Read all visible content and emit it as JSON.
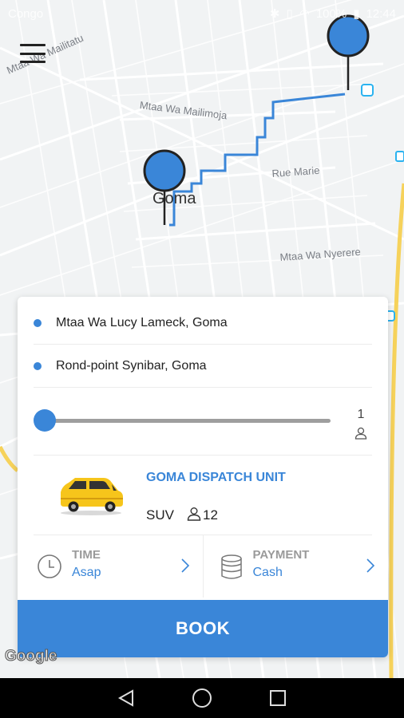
{
  "status_bar": {
    "carrier": "Congo",
    "battery": "100%",
    "time": "12:44"
  },
  "map": {
    "labels": {
      "street_1": "Mtaa Wa Mailitatu",
      "street_2": "Mtaa Wa Mailimoja",
      "street_3": "Rue Marie",
      "street_4": "Mtaa Wa Nyerere",
      "city": "Goma"
    },
    "route_color": "#3a86d8",
    "pin_color": "#3a86d8"
  },
  "booking": {
    "pickup": "Mtaa Wa Lucy Lameck, Goma",
    "dropoff": "Rond-point Synibar, Goma",
    "passengers": "1",
    "vehicle": {
      "name": "GOMA DISPATCH UNIT",
      "type": "SUV",
      "seats": "12"
    },
    "time": {
      "label": "TIME",
      "value": "Asap"
    },
    "payment": {
      "label": "PAYMENT",
      "value": "Cash"
    },
    "book_label": "BOOK"
  },
  "map_attribution": "Google",
  "colors": {
    "accent": "#3a86d8",
    "car_yellow": "#f6c51b"
  }
}
